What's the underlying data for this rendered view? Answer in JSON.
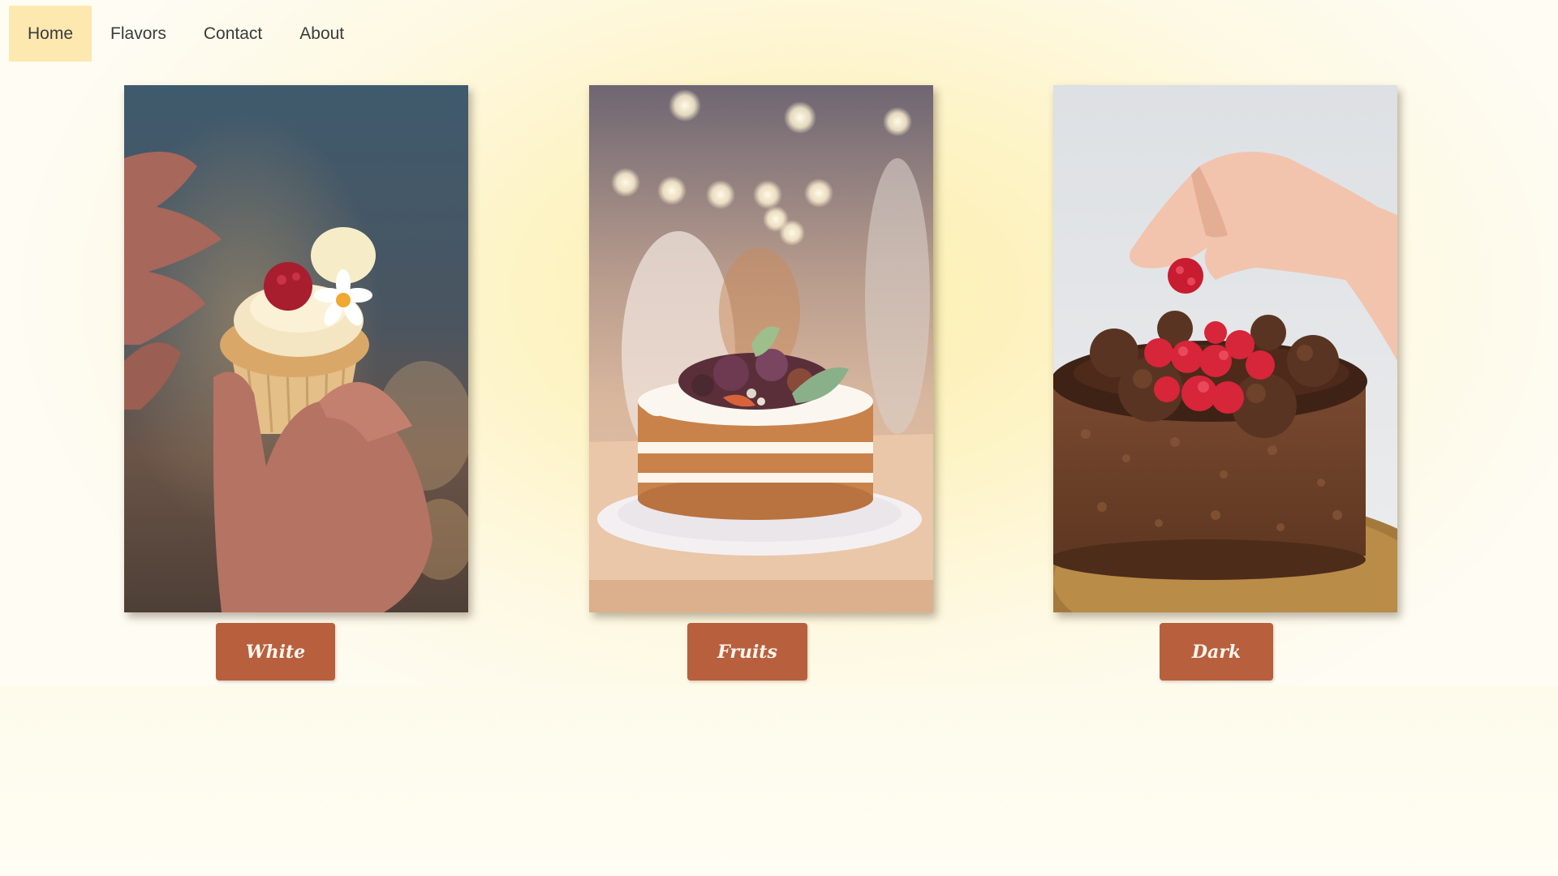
{
  "nav": {
    "items": [
      {
        "label": "Home",
        "active": true
      },
      {
        "label": "Flavors",
        "active": false
      },
      {
        "label": "Contact",
        "active": false
      },
      {
        "label": "About",
        "active": false
      }
    ]
  },
  "cards": [
    {
      "image_subject": "cupcake-photo",
      "button_label": "White"
    },
    {
      "image_subject": "naked-cake-photo",
      "button_label": "Fruits"
    },
    {
      "image_subject": "chocolate-cake-photo",
      "button_label": "Dark"
    }
  ],
  "colors": {
    "accent_button": "#b8603e",
    "active_nav": "#fde8b0",
    "background_glow": "#fcf0b0"
  }
}
